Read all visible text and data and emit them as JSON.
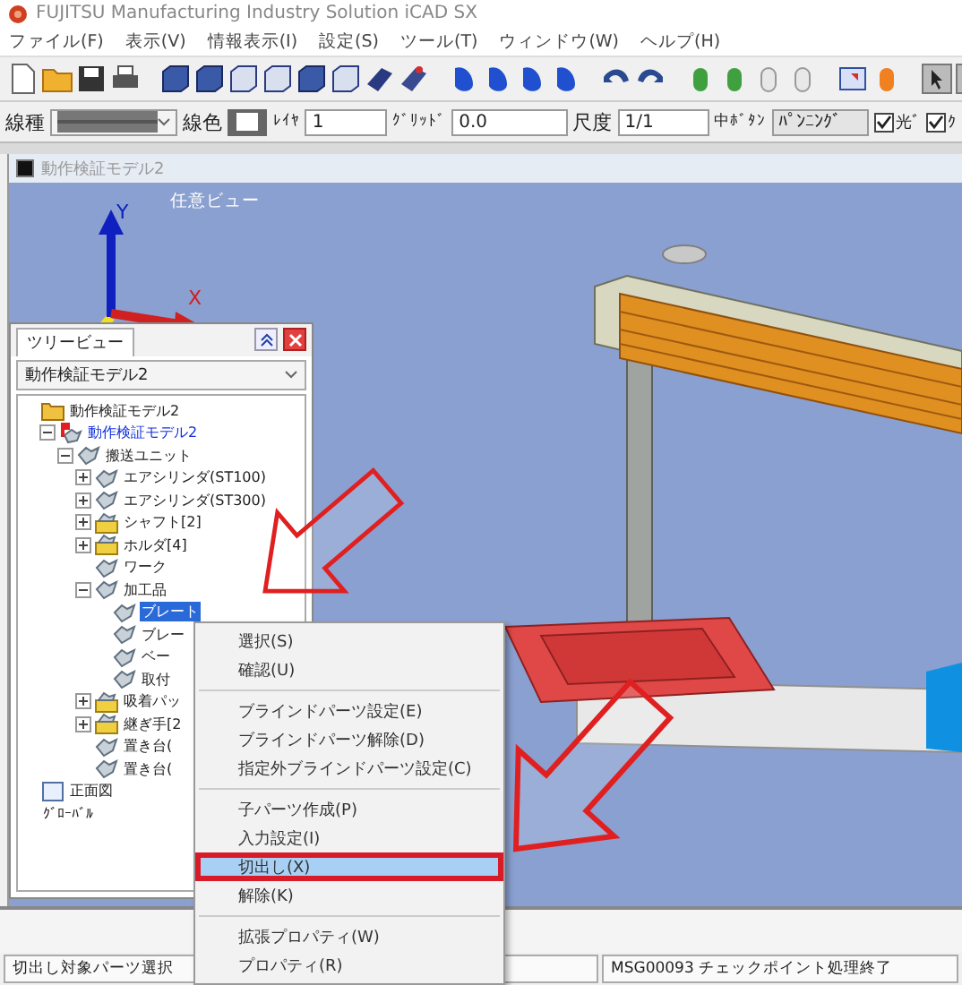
{
  "window": {
    "title": "FUJITSU Manufacturing Industry Solution iCAD SX"
  },
  "menu": [
    {
      "label": "ファイル(F)"
    },
    {
      "label": "表示(V)"
    },
    {
      "label": "情報表示(I)"
    },
    {
      "label": "設定(S)"
    },
    {
      "label": "ツール(T)"
    },
    {
      "label": "ウィンドウ(W)"
    },
    {
      "label": "ヘルプ(H)"
    }
  ],
  "property_bar": {
    "line_type_label": "線種",
    "line_color_label": "線色",
    "layer_label": "ﾚｲﾔ",
    "layer_value": "1",
    "grid_label": "ｸﾞﾘｯﾄﾞ",
    "grid_value": "0.0",
    "scale_label": "尺度",
    "scale_value": "1/1",
    "middle_button_label": "中ﾎﾞﾀﾝ",
    "middle_button_value": "ﾊﾟﾝﾆﾝｸﾞ",
    "checkboxes": [
      {
        "label": "光ﾞ",
        "checked": true
      },
      {
        "label": "ｸ",
        "checked": true
      }
    ]
  },
  "document": {
    "title": "動作検証モデル2",
    "view_label": "任意ビュー",
    "axes": {
      "y": "Y",
      "x": "X"
    }
  },
  "tree_view": {
    "tab": "ツリービュー",
    "model_select": "動作検証モデル2",
    "nodes": [
      {
        "label": "動作検証モデル2",
        "kind": "folder",
        "selected": false,
        "children": [
          {
            "label": "動作検証モデル2",
            "kind": "assembly",
            "active": true,
            "selected": false,
            "expanded": true,
            "children": [
              {
                "label": "搬送ユニット",
                "kind": "part",
                "selected": false,
                "expanded": true,
                "children": [
                  {
                    "label": "エアシリンダ(ST100)",
                    "kind": "part",
                    "selected": false,
                    "expanded": false
                  },
                  {
                    "label": "エアシリンダ(ST300)",
                    "kind": "part",
                    "selected": false,
                    "expanded": false
                  },
                  {
                    "label": "シャフト[2]",
                    "kind": "folder-part",
                    "selected": false,
                    "expanded": false
                  },
                  {
                    "label": "ホルダ[4]",
                    "kind": "folder-part",
                    "selected": false,
                    "expanded": false
                  },
                  {
                    "label": "ワーク",
                    "kind": "part",
                    "selected": false
                  },
                  {
                    "label": "加工品",
                    "kind": "part",
                    "selected": false,
                    "expanded": true,
                    "children": [
                      {
                        "label": "ブレート",
                        "kind": "part",
                        "selected": true
                      },
                      {
                        "label": "ブレー",
                        "kind": "part",
                        "selected": false
                      },
                      {
                        "label": "ベー",
                        "kind": "part",
                        "selected": false
                      },
                      {
                        "label": "取付",
                        "kind": "part",
                        "selected": false
                      }
                    ]
                  },
                  {
                    "label": "吸着パッ",
                    "kind": "folder-part",
                    "selected": false,
                    "expanded": false
                  },
                  {
                    "label": "継ぎ手[2",
                    "kind": "folder-part",
                    "selected": false,
                    "expanded": false
                  },
                  {
                    "label": "置き台(",
                    "kind": "part",
                    "selected": false
                  },
                  {
                    "label": "置き台(",
                    "kind": "part",
                    "selected": false
                  }
                ]
              }
            ]
          }
        ]
      },
      {
        "label": "正面図",
        "kind": "view",
        "selected": false
      },
      {
        "label": "ｸﾞﾛｰﾊﾞﾙ",
        "kind": "plain",
        "selected": false
      }
    ]
  },
  "context_menu": {
    "items": [
      {
        "kind": "item",
        "label": "選択(S)",
        "selected": false,
        "outlined": false
      },
      {
        "kind": "item",
        "label": "確認(U)",
        "selected": false,
        "outlined": false
      },
      {
        "kind": "separator"
      },
      {
        "kind": "item",
        "label": "ブラインドパーツ設定(E)",
        "selected": false,
        "outlined": false
      },
      {
        "kind": "item",
        "label": "ブラインドパーツ解除(D)",
        "selected": false,
        "outlined": false
      },
      {
        "kind": "item",
        "label": "指定外ブラインドパーツ設定(C)",
        "selected": false,
        "outlined": false
      },
      {
        "kind": "separator"
      },
      {
        "kind": "item",
        "label": "子パーツ作成(P)",
        "selected": false,
        "outlined": false
      },
      {
        "kind": "item",
        "label": "入力設定(I)",
        "selected": false,
        "outlined": false
      },
      {
        "kind": "item",
        "label": "切出し(X)",
        "selected": true,
        "outlined": true
      },
      {
        "kind": "item",
        "label": "解除(K)",
        "selected": false,
        "outlined": false
      },
      {
        "kind": "separator"
      },
      {
        "kind": "item",
        "label": "拡張プロパティ(W)",
        "selected": false,
        "outlined": false
      },
      {
        "kind": "item",
        "label": "プロパティ(R)",
        "selected": false,
        "outlined": false
      }
    ]
  },
  "status_bar": {
    "left": "切出し対象パーツ選択",
    "right": "MSG00093 チェックポイント処理終了"
  }
}
